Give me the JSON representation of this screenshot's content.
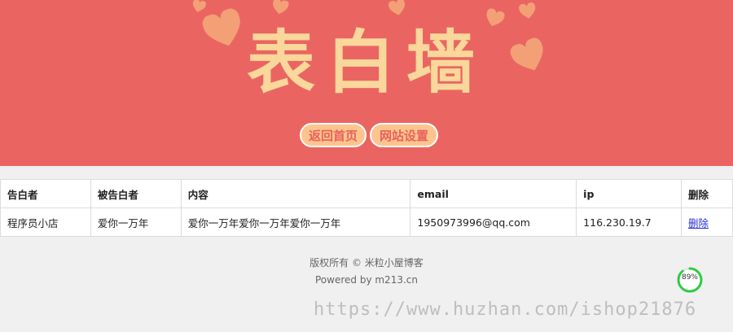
{
  "banner": {
    "title": "表白墙",
    "background_color": "#ea6562",
    "title_color": "#fad79a",
    "buttons": {
      "home_label": "返回首页",
      "settings_label": "网站设置"
    }
  },
  "table": {
    "headers": [
      "告白者",
      "被告白者",
      "内容",
      "email",
      "ip",
      "删除"
    ],
    "rows": [
      {
        "sender": "程序员小店",
        "recipient": "爱你一万年",
        "content": "爱你一万年爱你一万年爱你一万年",
        "email": "1950973996@qq.com",
        "ip": "116.230.19.7",
        "delete_label": "删除"
      }
    ]
  },
  "footer": {
    "copyright": "版权所有 © 米粒小屋博客",
    "powered": "Powered by m213.cn"
  },
  "progress_indicator": {
    "value": 0.89,
    "label": "89%"
  },
  "watermark": "https://www.huzhan.com/ishop21876"
}
